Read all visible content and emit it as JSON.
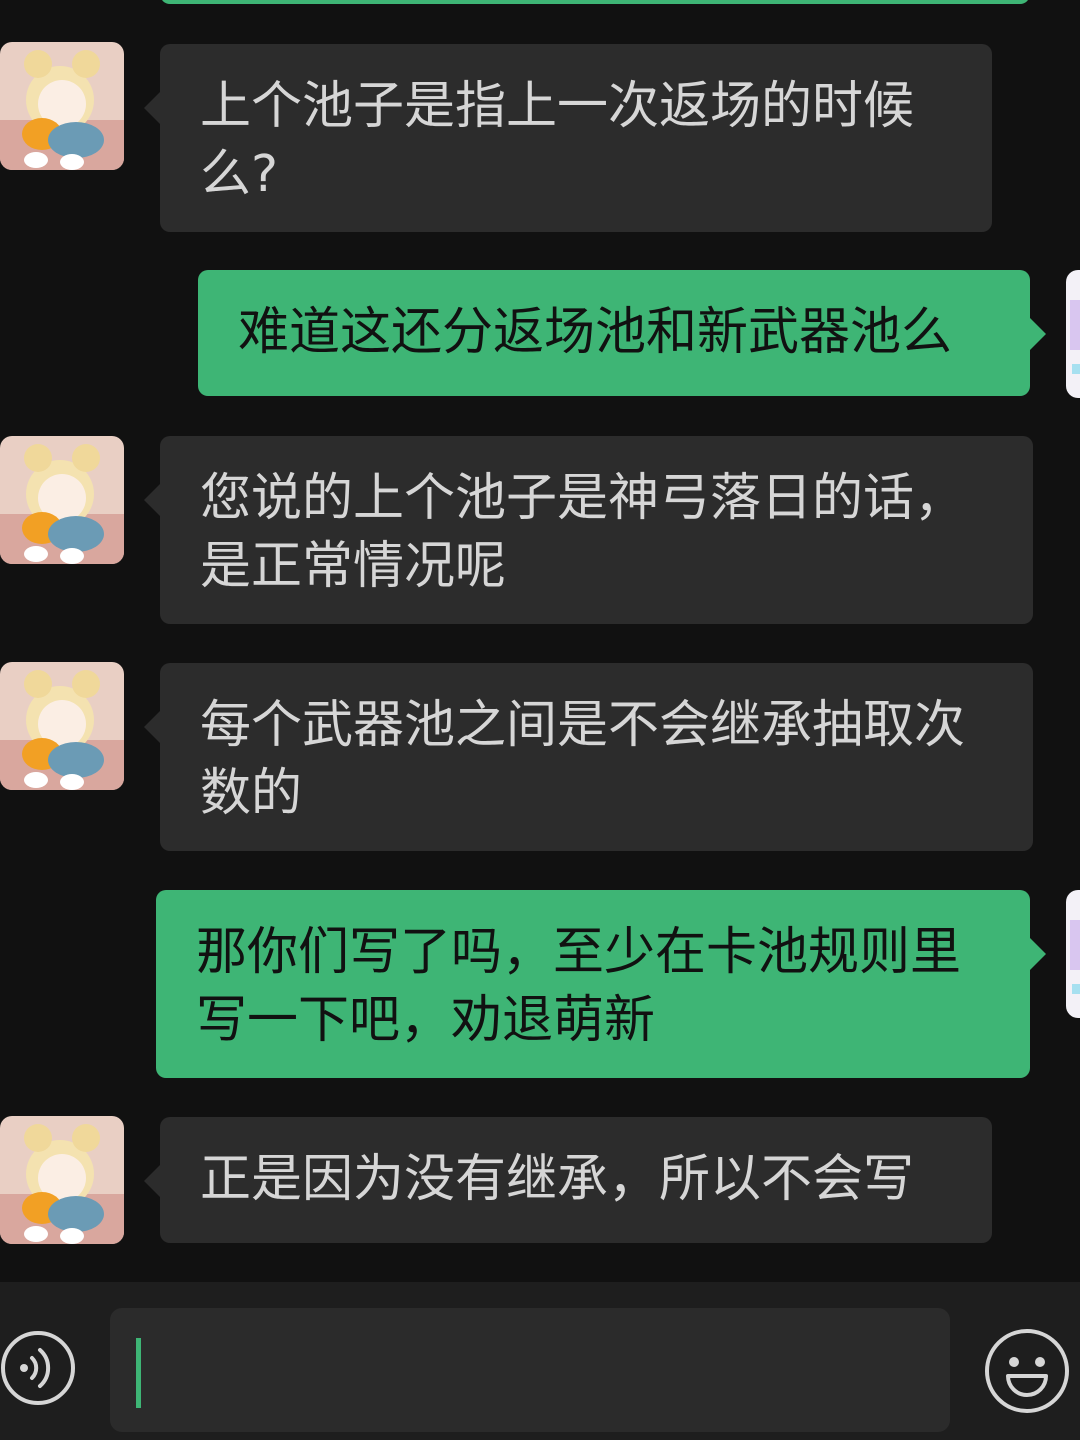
{
  "messages": [
    {
      "side": "in",
      "text": "上个池子是指上一次返场的时候\n么?"
    },
    {
      "side": "out",
      "text": "难道这还分返场池和新武器池么"
    },
    {
      "side": "in",
      "text": "您说的上个池子是神弓落日的话，\n是正常情况呢"
    },
    {
      "side": "in",
      "text": "每个武器池之间是不会继承抽取次\n数的"
    },
    {
      "side": "out",
      "text": "那你们写了吗，至少在卡池规则里\n写一下吧，劝退萌新"
    },
    {
      "side": "in",
      "text": "正是因为没有继承，所以不会写"
    }
  ],
  "input": {
    "value": ""
  },
  "icons": {
    "voice": "voice-icon",
    "emoji": "emoji-icon"
  },
  "colors": {
    "background": "#111111",
    "incoming_bubble": "#2c2c2c",
    "outgoing_bubble": "#3eb575",
    "input_bar": "#1e1e1e"
  }
}
